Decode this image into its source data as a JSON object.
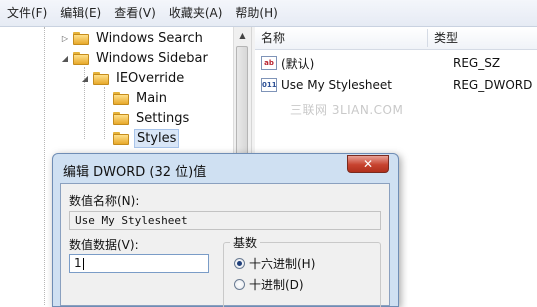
{
  "menubar": {
    "items": [
      "文件(F)",
      "编辑(E)",
      "查看(V)",
      "收藏夹(A)",
      "帮助(H)"
    ]
  },
  "tree": {
    "items": [
      {
        "label": "Windows Search",
        "expander": "▷"
      },
      {
        "label": "Windows Sidebar",
        "expander": "◢"
      },
      {
        "label": "IEOverride",
        "expander": "◢"
      },
      {
        "label": "Main",
        "expander": ""
      },
      {
        "label": "Settings",
        "expander": ""
      },
      {
        "label": "Styles",
        "expander": "",
        "selected": true
      }
    ],
    "scroll_up": "▲"
  },
  "list": {
    "headers": {
      "name": "名称",
      "type": "类型"
    },
    "rows": [
      {
        "icon": "ab",
        "icon_name": "string-value-icon",
        "name": "(默认)",
        "type": "REG_SZ"
      },
      {
        "icon": "011",
        "icon_name": "dword-value-icon",
        "name": "Use My Stylesheet",
        "type": "REG_DWORD"
      }
    ]
  },
  "watermark": "三联网 3LIAN.COM",
  "dialog": {
    "title": "编辑 DWORD (32 位)值",
    "close": "✕",
    "name_label": "数值名称(N):",
    "name_value": "Use My Stylesheet",
    "data_label": "数值数据(V):",
    "data_value": "1",
    "base_label": "基数",
    "radios": [
      {
        "label": "十六进制(H)",
        "checked": true
      },
      {
        "label": "十进制(D)",
        "checked": false
      }
    ]
  },
  "colors": {
    "accent": "#1f3f7a",
    "selection": "#d9e6f7",
    "dialog_frame": "#cfe0f2",
    "close_button": "#c7432f"
  }
}
